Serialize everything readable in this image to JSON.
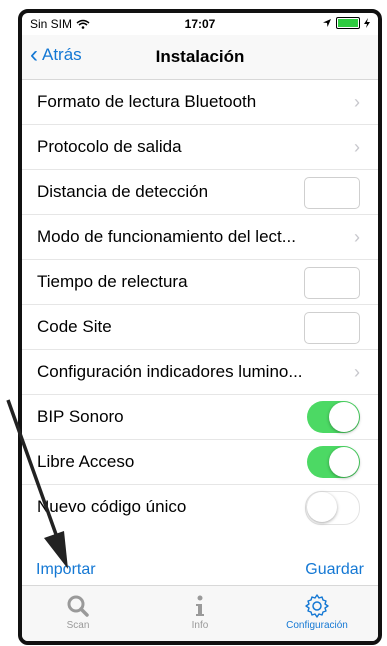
{
  "status": {
    "carrier": "Sin SIM",
    "time": "17:07"
  },
  "nav": {
    "back_label": "Atrás",
    "title": "Instalación"
  },
  "rows": [
    {
      "label": "Formato de lectura Bluetooth"
    },
    {
      "label": "Protocolo de salida"
    },
    {
      "label": "Distancia de detección"
    },
    {
      "label": "Modo de funcionamiento del lect..."
    },
    {
      "label": "Tiempo de relectura"
    },
    {
      "label": "Code Site"
    },
    {
      "label": "Configuración indicadores lumino..."
    },
    {
      "label": "BIP Sonoro",
      "toggle": true
    },
    {
      "label": "Libre Acceso",
      "toggle": true
    },
    {
      "label": "Nuevo código único",
      "toggle": false
    }
  ],
  "actions": {
    "import_label": "Importar",
    "save_label": "Guardar"
  },
  "tabs": [
    {
      "label": "Scan",
      "icon": "search-icon"
    },
    {
      "label": "Info",
      "icon": "info-icon"
    },
    {
      "label": "Configuración",
      "icon": "gear-icon",
      "active": true
    }
  ],
  "colors": {
    "accent": "#1478d4",
    "toggle_on": "#4cd964"
  }
}
